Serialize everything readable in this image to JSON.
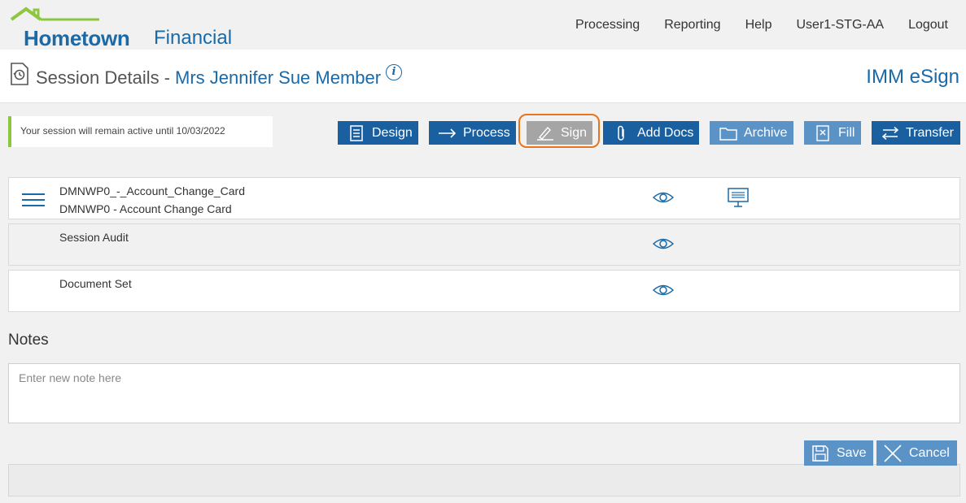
{
  "brand": {
    "name_bold": "Hometown",
    "name_light": "Financial",
    "colors": {
      "primary": "#1a6aa8",
      "roof": "#8dc63f"
    }
  },
  "nav": [
    "Processing",
    "Reporting",
    "Help",
    "User1-STG-AA",
    "Logout"
  ],
  "title": {
    "label": "Session Details -",
    "member_name": "Mrs Jennifer Sue Member",
    "info_glyph": "i",
    "app_name": "IMM eSign"
  },
  "session_notice": "Your session will remain active until 10/03/2022",
  "toolbar": [
    {
      "label": "Design",
      "icon": "document-list-icon",
      "state": "enabled"
    },
    {
      "label": "Process",
      "icon": "arrow-right-icon",
      "state": "enabled"
    },
    {
      "label": "Sign",
      "icon": "pen-signature-icon",
      "state": "active-highlighted"
    },
    {
      "label": "Add Docs",
      "icon": "paperclip-icon",
      "state": "enabled"
    },
    {
      "label": "Archive",
      "icon": "folder-icon",
      "state": "disabled"
    },
    {
      "label": "Fill",
      "icon": "fill-form-icon",
      "state": "disabled"
    },
    {
      "label": "Transfer",
      "icon": "transfer-arrows-icon",
      "state": "enabled"
    }
  ],
  "documents": [
    {
      "line1": "DMNWP0_-_Account_Change_Card",
      "line2": "DMNWP0 - Account Change Card",
      "has_menu": true,
      "has_sign_station": true
    },
    {
      "line1": "Session Audit",
      "line2": "",
      "has_menu": false,
      "has_sign_station": false
    },
    {
      "line1": "Document Set",
      "line2": "",
      "has_menu": false,
      "has_sign_station": false
    }
  ],
  "notes": {
    "label": "Notes",
    "placeholder": "Enter new note here",
    "value": ""
  },
  "actions": {
    "save_label": "Save",
    "cancel_label": "Cancel"
  }
}
